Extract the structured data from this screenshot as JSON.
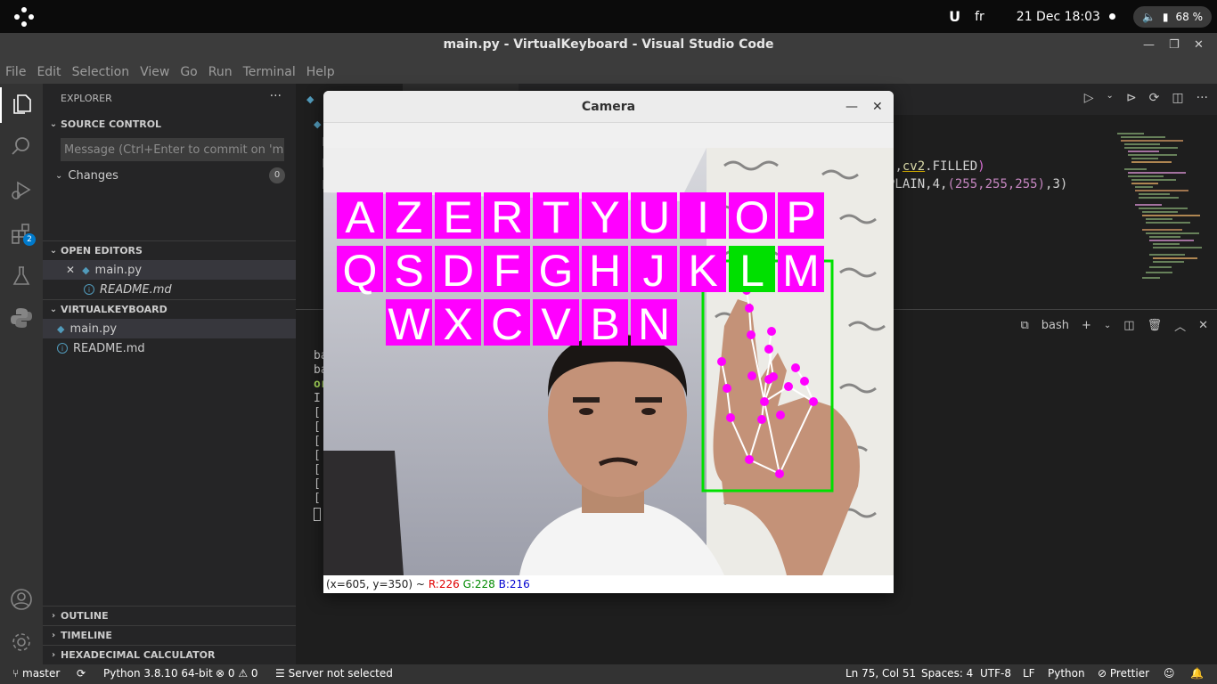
{
  "topbar": {
    "keyboard_layout": "fr",
    "datetime": "21 Dec  18:03",
    "battery": "68 %"
  },
  "window": {
    "title": "main.py - VirtualKeyboard - Visual Studio Code"
  },
  "menu": [
    "File",
    "Edit",
    "Selection",
    "View",
    "Go",
    "Run",
    "Terminal",
    "Help"
  ],
  "activity_bar": {
    "extensions_badge": "2"
  },
  "sidebar": {
    "explorer_title": "EXPLORER",
    "source_control": {
      "title": "SOURCE CONTROL",
      "commit_placeholder": "Message (Ctrl+Enter to commit on 'mas...",
      "changes_label": "Changes",
      "changes_count": "0"
    },
    "open_editors": {
      "title": "OPEN EDITORS",
      "items": [
        {
          "label": "main.py"
        },
        {
          "label": "README.md"
        }
      ]
    },
    "workspace": {
      "title": "VIRTUALKEYBOARD",
      "items": [
        {
          "label": "main.py"
        },
        {
          "label": "README.md"
        }
      ]
    },
    "collapsed": [
      "OUTLINE",
      "TIMELINE",
      "HEXADECIMAL CALCULATOR"
    ]
  },
  "editor": {
    "line1": {
      "a": ")",
      "b": ",",
      "c": "cv2",
      "d": ".FILLED",
      "e": ")"
    },
    "line2": {
      "a": "PLAIN,4,",
      "b": "(255,255,255)",
      "c": ",3)"
    }
  },
  "terminal": {
    "shell_label": "bash",
    "lines": [
      "ba",
      "ba",
      "or",
      "I",
      "[",
      "[",
      "[",
      "[",
      "[",
      "[",
      "["
    ]
  },
  "camera": {
    "title": "Camera",
    "keyboard_rows": [
      [
        "A",
        "Z",
        "E",
        "R",
        "T",
        "Y",
        "U",
        "I",
        "O",
        "P"
      ],
      [
        "Q",
        "S",
        "D",
        "F",
        "G",
        "H",
        "J",
        "K",
        "L",
        "M"
      ],
      [
        "W",
        "X",
        "C",
        "V",
        "B",
        "N"
      ]
    ],
    "highlighted_key": "L",
    "status": {
      "coords": "(x=605, y=350) ~",
      "r": "R:226",
      "g": "G:228",
      "b": "B:216"
    }
  },
  "statusbar": {
    "branch": "master",
    "python": "Python 3.8.10 64-bit",
    "errors": "0",
    "warnings": "0",
    "server": "Server not selected",
    "position": "Ln 75, Col 51",
    "spaces": "Spaces: 4",
    "encoding": "UTF-8",
    "eol": "LF",
    "language": "Python",
    "prettier": "Prettier"
  }
}
